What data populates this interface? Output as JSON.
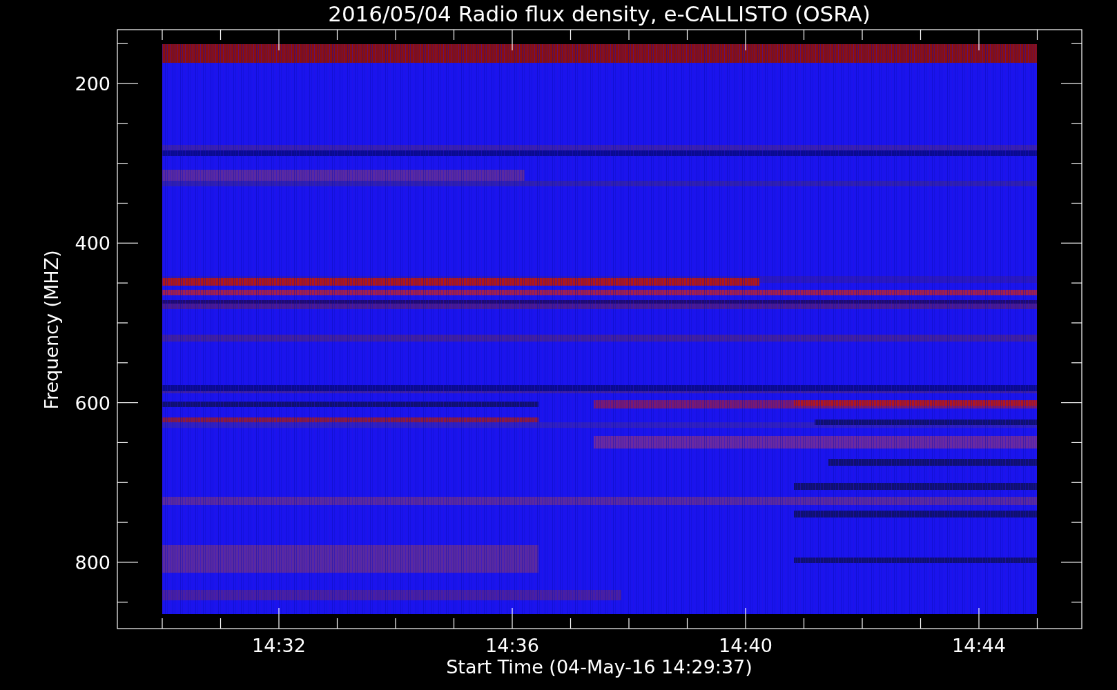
{
  "title": "2016/05/04  Radio flux density, e-CALLISTO (OSRA)",
  "y_axis": {
    "label": "Frequency (MHZ)",
    "tick_labels": [
      "200",
      "400",
      "600",
      "800"
    ]
  },
  "x_axis": {
    "label": "Start Time (04-May-16 14:29:37)",
    "tick_labels": [
      "14:32",
      "14:36",
      "14:40",
      "14:44"
    ]
  }
}
